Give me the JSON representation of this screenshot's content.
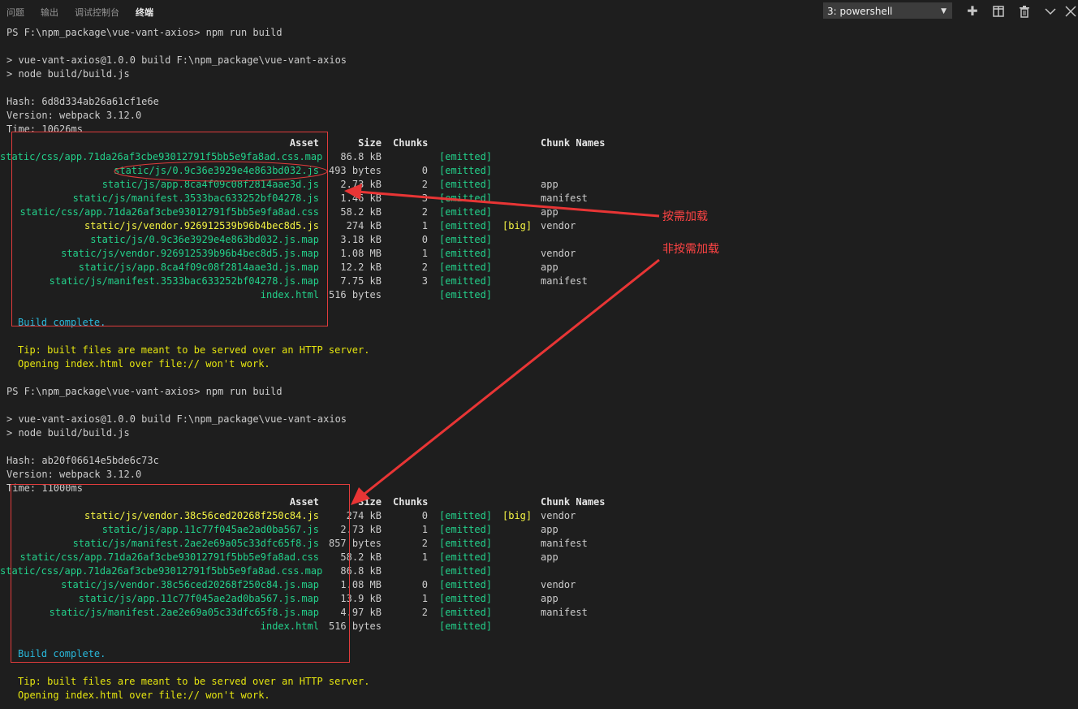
{
  "tabs": [
    "问题",
    "输出",
    "调试控制台",
    "终端"
  ],
  "active_tab": 3,
  "terminal_select": {
    "value": "3: powershell"
  },
  "toolbar_icons": [
    "plus-icon",
    "split-icon",
    "trash-icon",
    "chevron-down-icon",
    "close-icon"
  ],
  "runs": [
    {
      "prompt": "PS F:\\npm_package\\vue-vant-axios> npm run build",
      "cmd1": "> vue-vant-axios@1.0.0 build F:\\npm_package\\vue-vant-axios",
      "cmd2": "> node build/build.js",
      "hash": "Hash: 6d8d334ab26a61cf1e6e",
      "version": "Version: webpack 3.12.0",
      "time": "Time: 10626ms",
      "headers": {
        "asset": "Asset",
        "size": "Size",
        "chunks": "Chunks",
        "names": "Chunk Names"
      },
      "rows": [
        {
          "asset": "static/css/app.71da26af3cbe93012791f5bb5e9fa8ad.css.map",
          "size": "86.8 kB",
          "chunk": "",
          "emitted": "[emitted]",
          "big": "",
          "name": ""
        },
        {
          "asset": "static/js/0.9c36e3929e4e863bd032.js",
          "size": "493 bytes",
          "chunk": "0",
          "emitted": "[emitted]",
          "big": "",
          "name": ""
        },
        {
          "asset": "static/js/app.8ca4f09c08f2814aae3d.js",
          "size": "2.73 kB",
          "chunk": "2",
          "emitted": "[emitted]",
          "big": "",
          "name": "app"
        },
        {
          "asset": "static/js/manifest.3533bac633252bf04278.js",
          "size": "1.46 kB",
          "chunk": "3",
          "emitted": "[emitted]",
          "big": "",
          "name": "manifest"
        },
        {
          "asset": "static/css/app.71da26af3cbe93012791f5bb5e9fa8ad.css",
          "size": "58.2 kB",
          "chunk": "2",
          "emitted": "[emitted]",
          "big": "",
          "name": "app"
        },
        {
          "asset": "static/js/vendor.926912539b96b4bec8d5.js",
          "size": "274 kB",
          "chunk": "1",
          "emitted": "[emitted]",
          "big": "[big]",
          "name": "vendor"
        },
        {
          "asset": "static/js/0.9c36e3929e4e863bd032.js.map",
          "size": "3.18 kB",
          "chunk": "0",
          "emitted": "[emitted]",
          "big": "",
          "name": ""
        },
        {
          "asset": "static/js/vendor.926912539b96b4bec8d5.js.map",
          "size": "1.08 MB",
          "chunk": "1",
          "emitted": "[emitted]",
          "big": "",
          "name": "vendor"
        },
        {
          "asset": "static/js/app.8ca4f09c08f2814aae3d.js.map",
          "size": "12.2 kB",
          "chunk": "2",
          "emitted": "[emitted]",
          "big": "",
          "name": "app"
        },
        {
          "asset": "static/js/manifest.3533bac633252bf04278.js.map",
          "size": "7.75 kB",
          "chunk": "3",
          "emitted": "[emitted]",
          "big": "",
          "name": "manifest"
        },
        {
          "asset": "index.html",
          "size": "516 bytes",
          "chunk": "",
          "emitted": "[emitted]",
          "big": "",
          "name": ""
        }
      ],
      "complete": "Build complete.",
      "tip1": "Tip: built files are meant to be served over an HTTP server.",
      "tip2": "Opening index.html over file:// won't work."
    },
    {
      "prompt": "PS F:\\npm_package\\vue-vant-axios> npm run build",
      "cmd1": "> vue-vant-axios@1.0.0 build F:\\npm_package\\vue-vant-axios",
      "cmd2": "> node build/build.js",
      "hash": "Hash: ab20f06614e5bde6c73c",
      "version": "Version: webpack 3.12.0",
      "time": "Time: 11000ms",
      "headers": {
        "asset": "Asset",
        "size": "Size",
        "chunks": "Chunks",
        "names": "Chunk Names"
      },
      "rows": [
        {
          "asset": "static/js/vendor.38c56ced20268f250c84.js",
          "size": "274 kB",
          "chunk": "0",
          "emitted": "[emitted]",
          "big": "[big]",
          "name": "vendor"
        },
        {
          "asset": "static/js/app.11c77f045ae2ad0ba567.js",
          "size": "2.73 kB",
          "chunk": "1",
          "emitted": "[emitted]",
          "big": "",
          "name": "app"
        },
        {
          "asset": "static/js/manifest.2ae2e69a05c33dfc65f8.js",
          "size": "857 bytes",
          "chunk": "2",
          "emitted": "[emitted]",
          "big": "",
          "name": "manifest"
        },
        {
          "asset": "static/css/app.71da26af3cbe93012791f5bb5e9fa8ad.css",
          "size": "58.2 kB",
          "chunk": "1",
          "emitted": "[emitted]",
          "big": "",
          "name": "app"
        },
        {
          "asset": "static/css/app.71da26af3cbe93012791f5bb5e9fa8ad.css.map",
          "size": "86.8 kB",
          "chunk": "",
          "emitted": "[emitted]",
          "big": "",
          "name": ""
        },
        {
          "asset": "static/js/vendor.38c56ced20268f250c84.js.map",
          "size": "1.08 MB",
          "chunk": "0",
          "emitted": "[emitted]",
          "big": "",
          "name": "vendor"
        },
        {
          "asset": "static/js/app.11c77f045ae2ad0ba567.js.map",
          "size": "13.9 kB",
          "chunk": "1",
          "emitted": "[emitted]",
          "big": "",
          "name": "app"
        },
        {
          "asset": "static/js/manifest.2ae2e69a05c33dfc65f8.js.map",
          "size": "4.97 kB",
          "chunk": "2",
          "emitted": "[emitted]",
          "big": "",
          "name": "manifest"
        },
        {
          "asset": "index.html",
          "size": "516 bytes",
          "chunk": "",
          "emitted": "[emitted]",
          "big": "",
          "name": ""
        }
      ],
      "complete": "Build complete.",
      "tip1": "Tip: built files are meant to be served over an HTTP server.",
      "tip2": "Opening index.html over file:// won't work."
    }
  ],
  "annotations": {
    "on_demand": "按需加载",
    "not_on_demand": "非按需加载"
  },
  "colors": {
    "annotation": "#ff4444",
    "emitted": "#23d18b",
    "big": "#f5f543",
    "complete": "#29b8db"
  }
}
